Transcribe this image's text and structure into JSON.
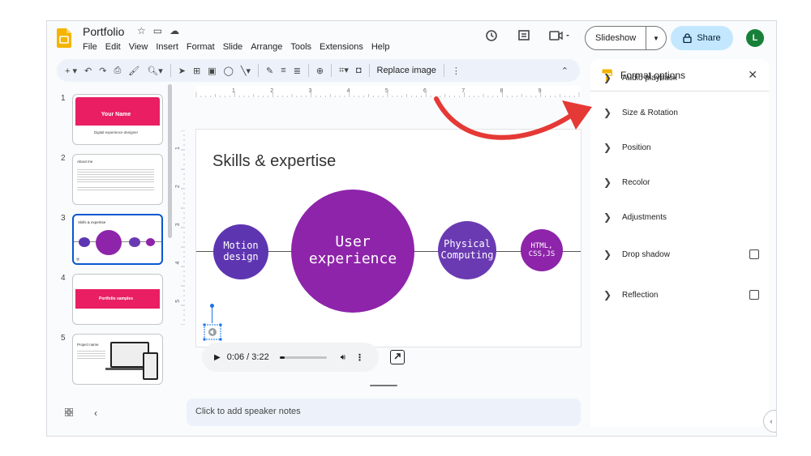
{
  "app": {
    "title": "Portfolio",
    "menu": [
      "File",
      "Edit",
      "View",
      "Insert",
      "Format",
      "Slide",
      "Arrange",
      "Tools",
      "Extensions",
      "Help"
    ],
    "slideshow_label": "Slideshow",
    "share_label": "Share",
    "avatar_initial": "L",
    "accent": "#0b57d0"
  },
  "toolbar": {
    "replace_image_label": "Replace image"
  },
  "filmstrip": {
    "slides": [
      {
        "number": "1",
        "title": "Your Name",
        "subtitle": "Digital experience designer"
      },
      {
        "number": "2",
        "title": "About me"
      },
      {
        "number": "3",
        "title": "Skills & expertise"
      },
      {
        "number": "4",
        "title": "Portfolio samples"
      },
      {
        "number": "5",
        "title": "Project name"
      }
    ],
    "active_index": 2
  },
  "ruler": {
    "marks": [
      "1",
      "2",
      "3",
      "4",
      "5",
      "6",
      "7",
      "8",
      "9"
    ],
    "vmarks": [
      "1",
      "2",
      "3",
      "4",
      "5"
    ]
  },
  "slide": {
    "title": "Skills & expertise",
    "bubbles": [
      {
        "text": "Motion\ndesign",
        "color": "#5e35b1"
      },
      {
        "text": "User\nexperience",
        "color": "#8e24aa"
      },
      {
        "text": "Physical\nComputing",
        "color": "#6a3ab2"
      },
      {
        "text": "HTML,\nCSS,JS",
        "color": "#8e24aa"
      }
    ]
  },
  "audio": {
    "time": "0:06 / 3:22",
    "progress_fraction": 0.03
  },
  "notes": {
    "placeholder": "Click to add speaker notes"
  },
  "panel": {
    "title": "Format options",
    "options": [
      {
        "label": "Audio playback",
        "checkbox": false
      },
      {
        "label": "Size & Rotation",
        "checkbox": false
      },
      {
        "label": "Position",
        "checkbox": false
      },
      {
        "label": "Recolor",
        "checkbox": false
      },
      {
        "label": "Adjustments",
        "checkbox": false
      },
      {
        "label": "Drop shadow",
        "checkbox": true
      },
      {
        "label": "Reflection",
        "checkbox": true
      }
    ]
  },
  "annotation": {
    "arrow_color": "#e53935"
  }
}
